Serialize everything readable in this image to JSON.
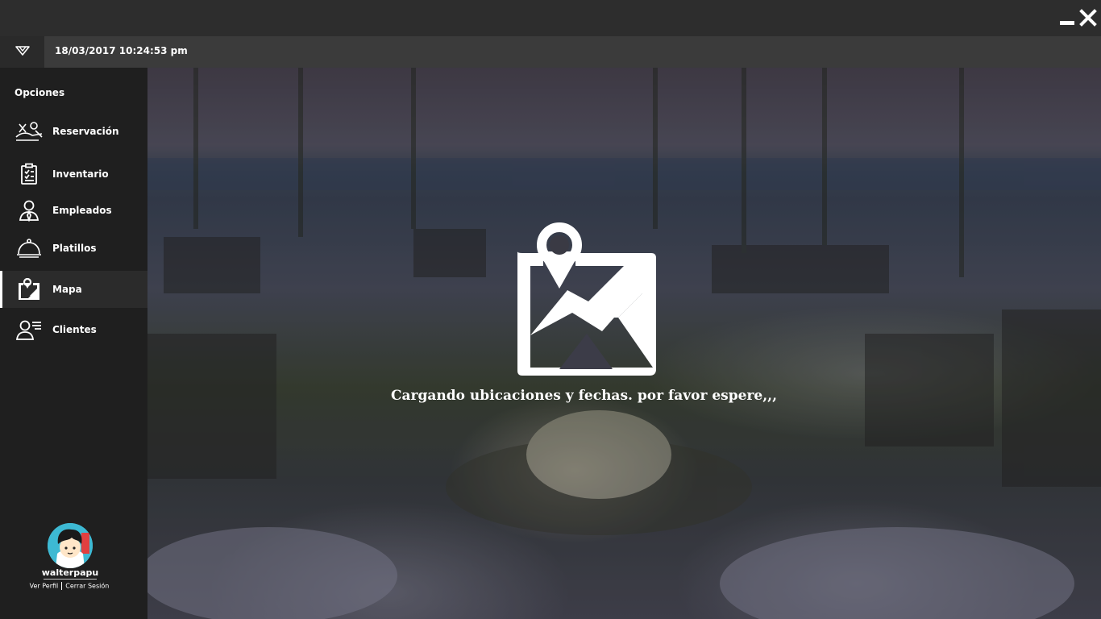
{
  "window": {
    "minimize_icon": "minimize-icon",
    "close_icon": "close-icon"
  },
  "topbar": {
    "menu_icon": "chevron-down-icon",
    "datetime": "18/03/2017 10:24:53 pm"
  },
  "sidebar": {
    "heading": "Opciones",
    "items": [
      {
        "label": "Reservación",
        "icon": "reservation-icon",
        "active": false
      },
      {
        "label": "Inventario",
        "icon": "clipboard-icon",
        "active": false
      },
      {
        "label": "Empleados",
        "icon": "employee-icon",
        "active": false
      },
      {
        "label": "Platillos",
        "icon": "dish-cloche-icon",
        "active": false
      },
      {
        "label": "Mapa",
        "icon": "map-icon",
        "active": true
      },
      {
        "label": "Clientes",
        "icon": "clients-icon",
        "active": false
      }
    ]
  },
  "profile": {
    "username": "walterpapu",
    "view_profile": "Ver Perfil",
    "logout": "Cerrar Sesión"
  },
  "main": {
    "loading_icon": "map-pin-icon",
    "loading_text": "Cargando ubicaciones y fechas. por favor espere,,,"
  }
}
